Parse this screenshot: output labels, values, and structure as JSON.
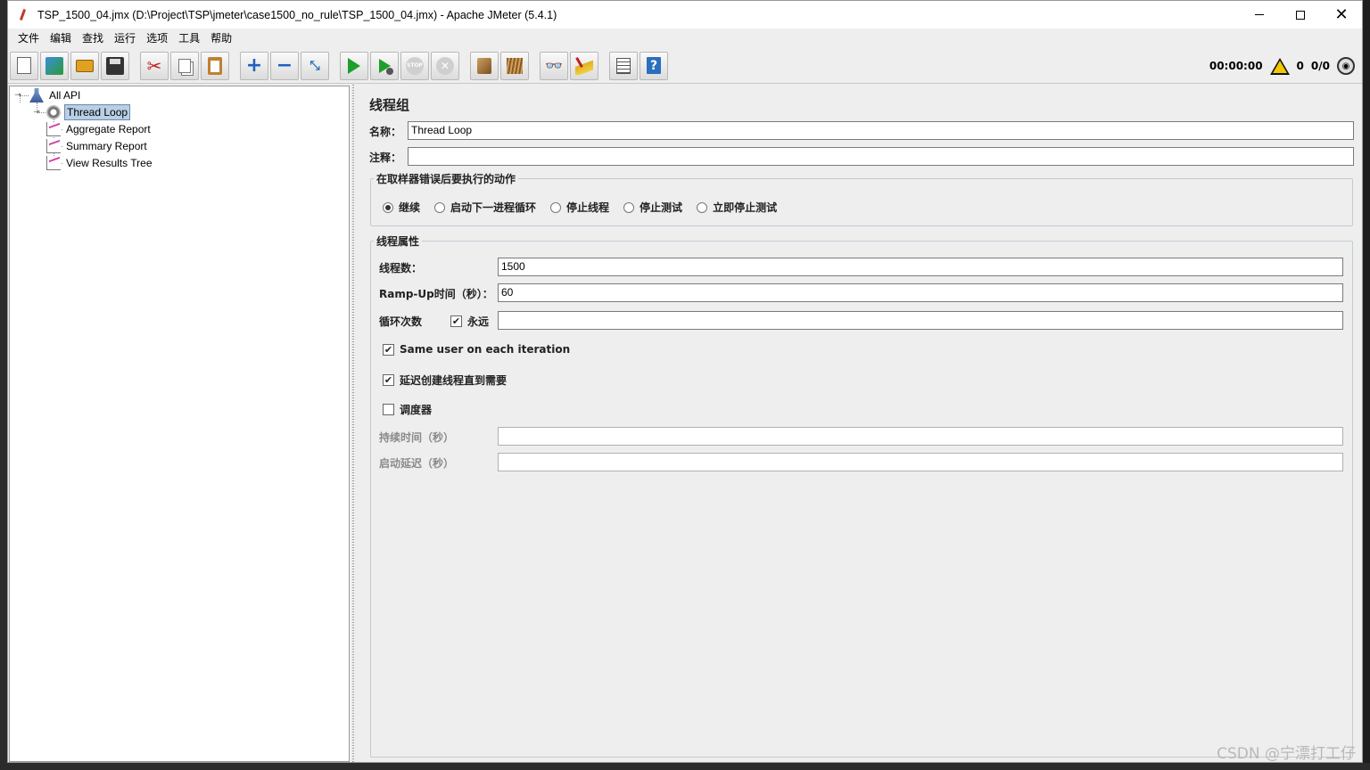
{
  "window": {
    "title": "TSP_1500_04.jmx (D:\\Project\\TSP\\jmeter\\case1500_no_rule\\TSP_1500_04.jmx) - Apache JMeter (5.4.1)"
  },
  "menu": [
    "文件",
    "编辑",
    "查找",
    "运行",
    "选项",
    "工具",
    "帮助"
  ],
  "toolbar": {
    "buttons": [
      {
        "name": "new-icon"
      },
      {
        "name": "templates-icon"
      },
      {
        "name": "open-icon"
      },
      {
        "name": "save-icon"
      },
      {
        "name": "cut-icon"
      },
      {
        "name": "copy-icon"
      },
      {
        "name": "paste-icon"
      },
      {
        "name": "expand-icon"
      },
      {
        "name": "collapse-icon"
      },
      {
        "name": "toggle-icon"
      },
      {
        "name": "start-icon"
      },
      {
        "name": "start-no-pauses-icon"
      },
      {
        "name": "stop-icon"
      },
      {
        "name": "shutdown-icon"
      },
      {
        "name": "clear-icon"
      },
      {
        "name": "clear-all-icon"
      },
      {
        "name": "search-icon"
      },
      {
        "name": "reset-search-icon"
      },
      {
        "name": "function-helper-icon"
      },
      {
        "name": "help-icon"
      }
    ],
    "status": {
      "elapsed": "00:00:00",
      "warnings": "0",
      "threads": "0/0"
    }
  },
  "tree": {
    "root": "All API",
    "thread_group": "Thread Loop",
    "listeners": [
      "Aggregate Report",
      "Summary Report",
      "View Results Tree"
    ]
  },
  "editor": {
    "title": "线程组",
    "name_label": "名称：",
    "name_value": "Thread Loop",
    "comment_label": "注释：",
    "comment_value": "",
    "error_action": {
      "title": "在取样器错误后要执行的动作",
      "options": [
        "继续",
        "启动下一进程循环",
        "停止线程",
        "停止测试",
        "立即停止测试"
      ],
      "selected_index": 0
    },
    "thread_props": {
      "title": "线程属性",
      "threads_label": "线程数：",
      "threads_value": "1500",
      "rampup_label": "Ramp-Up时间（秒）：",
      "rampup_value": "60",
      "loop_label": "循环次数",
      "forever_label": "永远",
      "forever_checked": true,
      "loop_value": "",
      "same_user_label": "Same user on each iteration",
      "same_user_checked": true,
      "delay_label": "延迟创建线程直到需要",
      "delay_checked": true,
      "scheduler_label": "调度器",
      "scheduler_checked": false,
      "duration_label": "持续时间（秒）",
      "duration_value": "",
      "startup_delay_label": "启动延迟（秒）",
      "startup_delay_value": ""
    }
  },
  "watermark": "CSDN @宁漂打工仔"
}
